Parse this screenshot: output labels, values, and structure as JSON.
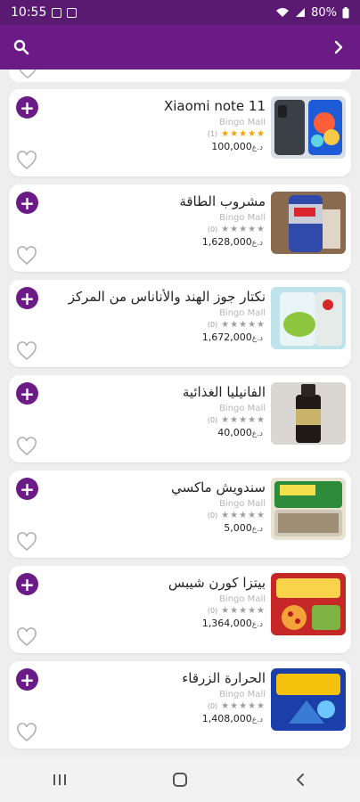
{
  "status_bar": {
    "time": "10:55",
    "battery": "80%"
  },
  "app_bar": {
    "search_icon": "search-icon",
    "forward_icon": "chevron-right-icon"
  },
  "products": [
    {
      "title": "Xiaomi note 11",
      "store": "Bingo Mall",
      "rating_count": "(1)",
      "stars_filled": 5,
      "price": "100,000",
      "currency": "د.ع",
      "image": "phone-image"
    },
    {
      "title": "مشروب الطاقة",
      "store": "Bingo Mall",
      "rating_count": "(0)",
      "stars_filled": 0,
      "price": "1,628,000",
      "currency": "د.ع",
      "image": "energy-drink-image"
    },
    {
      "title": "نكتار جوز الهند والأناناس من المركز",
      "store": "Bingo Mall",
      "rating_count": "(0)",
      "stars_filled": 0,
      "price": "1,672,000",
      "currency": "د.ع",
      "image": "nectar-image"
    },
    {
      "title": "الفانيليا الغذائية",
      "store": "Bingo Mall",
      "rating_count": "(0)",
      "stars_filled": 0,
      "price": "40,000",
      "currency": "د.ع",
      "image": "vanilla-image"
    },
    {
      "title": "سندويش ماكسي",
      "store": "Bingo Mall",
      "rating_count": "(0)",
      "stars_filled": 0,
      "price": "5,000",
      "currency": "د.ع",
      "image": "sandwich-image"
    },
    {
      "title": "بيتزا كورن شيبس",
      "store": "Bingo Mall",
      "rating_count": "(0)",
      "stars_filled": 0,
      "price": "1,364,000",
      "currency": "د.ع",
      "image": "pizza-chips-image"
    },
    {
      "title": "الحرارة الزرقاء",
      "store": "Bingo Mall",
      "rating_count": "(0)",
      "stars_filled": 0,
      "price": "1,408,000",
      "currency": "د.ع",
      "image": "takis-image"
    }
  ],
  "colors": {
    "brand": "#6a1b86",
    "star_gold": "#f5a000",
    "star_gray": "#9e9e9e"
  },
  "nav": {
    "recent_icon": "recent-apps-icon",
    "home_icon": "home-icon",
    "back_icon": "back-icon"
  }
}
